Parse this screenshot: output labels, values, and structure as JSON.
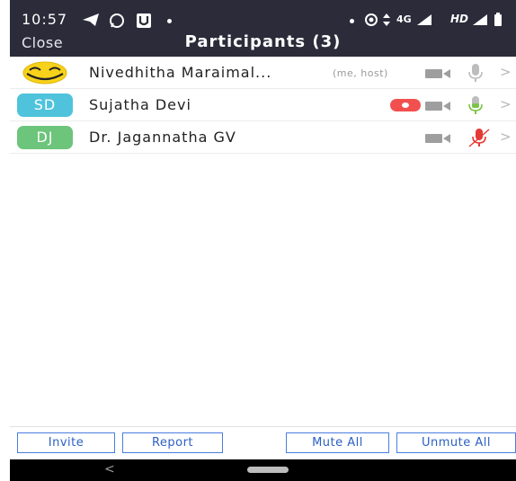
{
  "status_bar": {
    "time": "10:57",
    "network": "4G",
    "hd_label": "HD"
  },
  "header": {
    "close_label": "Close",
    "title": "Participants (3)"
  },
  "participants": [
    {
      "name": "Nivedhitha Maraimal...",
      "tag": "(me, host)",
      "avatar": "smiley-face-image",
      "mic_state": "muted-gray",
      "video": "off",
      "recording": false
    },
    {
      "name": "Sujatha Devi",
      "initials": "SD",
      "avatar_color": "#4fc3dc",
      "mic_state": "active-green",
      "video": "off",
      "recording": true
    },
    {
      "name": "Dr. Jagannatha GV",
      "initials": "DJ",
      "avatar_color": "#6cc57a",
      "mic_state": "muted-red",
      "video": "off",
      "recording": false
    }
  ],
  "actions": {
    "invite": "Invite",
    "report": "Report",
    "mute_all": "Mute All",
    "unmute_all": "Unmute All"
  },
  "colors": {
    "header_bg": "#2b2b3a",
    "accent_blue": "#4a7ee0",
    "record_red": "#f2504f",
    "mic_green": "#7cc34a",
    "mic_red": "#e53935"
  },
  "nav": {
    "back_glyph": "<"
  }
}
